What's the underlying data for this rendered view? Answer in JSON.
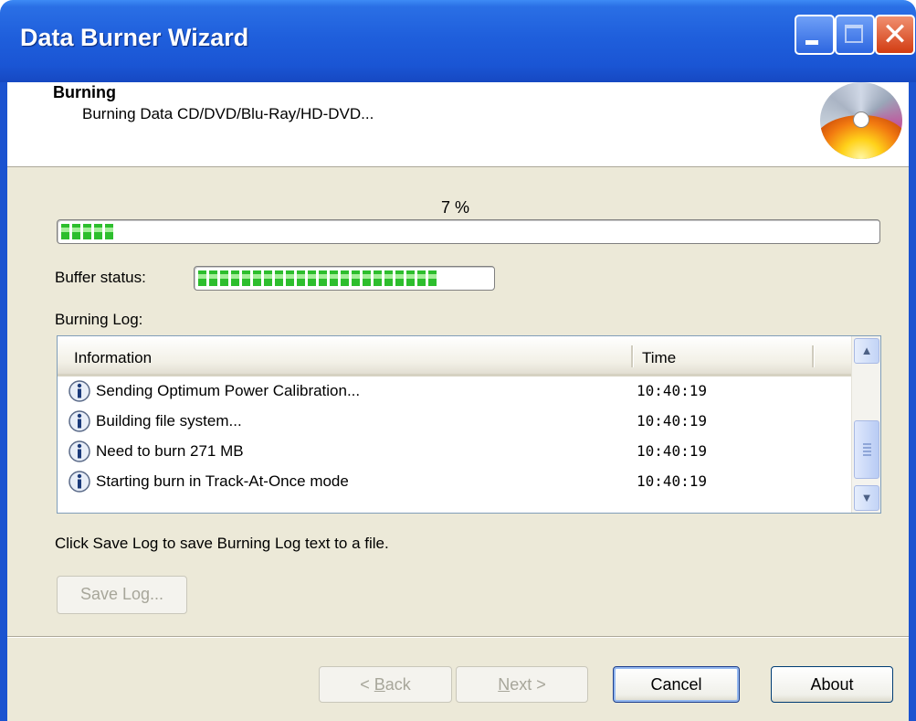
{
  "window": {
    "title": "Data Burner Wizard",
    "controls": [
      "minimize",
      "maximize",
      "close"
    ],
    "close_glyph": "✕"
  },
  "header": {
    "title": "Burning",
    "subtitle": "Burning Data CD/DVD/Blu-Ray/HD-DVD..."
  },
  "progress": {
    "percent_label": "7 %",
    "value": 0.07
  },
  "buffer": {
    "label": "Buffer status:",
    "value": 0.82
  },
  "log": {
    "label": "Burning Log:",
    "columns": [
      "Information",
      "Time"
    ],
    "rows": [
      {
        "icon": "info-icon",
        "message": "Sending Optimum Power Calibration...",
        "time": "10:40:19"
      },
      {
        "icon": "info-icon",
        "message": "Building file system...",
        "time": "10:40:19"
      },
      {
        "icon": "info-icon",
        "message": "Need to burn 271 MB",
        "time": "10:40:19"
      },
      {
        "icon": "info-icon",
        "message": "Starting burn in Track-At-Once mode",
        "time": "10:40:19"
      }
    ],
    "scroll": {
      "up_glyph": "▲",
      "down_glyph": "▼"
    }
  },
  "hint": "Click Save Log to save Burning Log text to a file.",
  "buttons": {
    "save_log": {
      "label": "Save Log...",
      "enabled": false
    },
    "back": {
      "prefix": "< ",
      "accel": "B",
      "rest": "ack",
      "enabled": false
    },
    "next": {
      "accel": "N",
      "rest": "ext >",
      "enabled": false
    },
    "cancel": {
      "label": "Cancel",
      "enabled": true
    },
    "about": {
      "label": "About",
      "enabled": true
    }
  },
  "colors": {
    "titlebar": "#1f5fdc",
    "progress_green": "#2dbe2d",
    "dialog_bg": "#ece9d8"
  }
}
